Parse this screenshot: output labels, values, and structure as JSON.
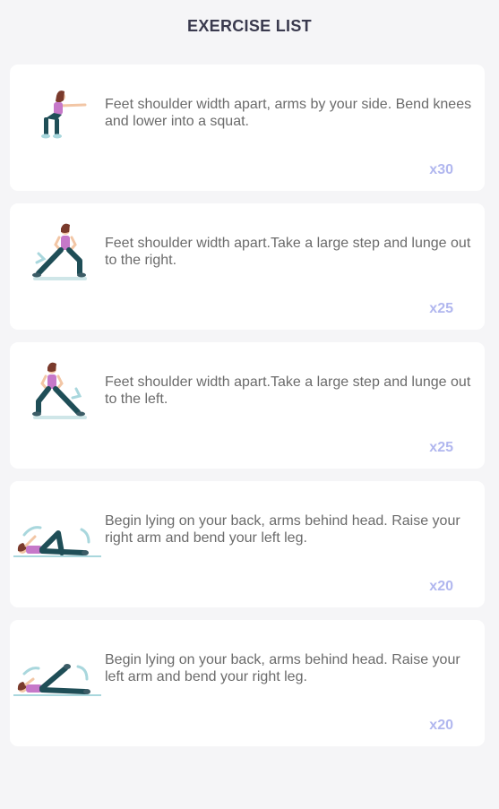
{
  "header": {
    "title": "EXERCISE LIST"
  },
  "exercises": [
    {
      "icon": "squat-figure-icon",
      "description": "Feet shoulder width apart, arms by your side. Bend knees and lower into a squat.",
      "reps": "x30"
    },
    {
      "icon": "side-lunge-right-figure-icon",
      "description": "Feet shoulder width apart.Take a large step and lunge out to the right.",
      "reps": "x25"
    },
    {
      "icon": "side-lunge-left-figure-icon",
      "description": "Feet shoulder width apart.Take a large step and lunge out to the left.",
      "reps": "x25"
    },
    {
      "icon": "lying-crunch-right-figure-icon",
      "description": "Begin lying on your back, arms behind head. Raise your right arm and bend your left leg.",
      "reps": "x20"
    },
    {
      "icon": "lying-crunch-left-figure-icon",
      "description": "Begin lying on your back, arms behind head. Raise your left arm and bend your right leg.",
      "reps": "x20"
    }
  ],
  "colors": {
    "background": "#f5f5f7",
    "card": "#ffffff",
    "title": "#3a3a4e",
    "text": "#6b6b6b",
    "reps": "#b1b7ef",
    "shirt": "#c678c9",
    "pants": "#1f4e57",
    "skin": "#f2c6a5",
    "hair": "#7a3a2c",
    "arrow": "#a9d7dd"
  }
}
